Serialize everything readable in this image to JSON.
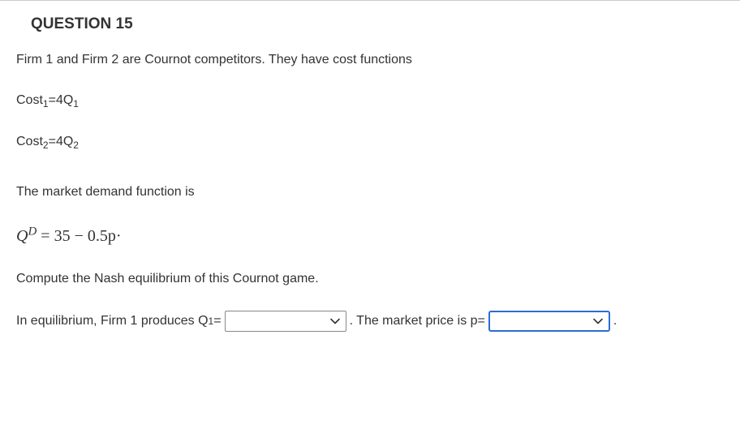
{
  "question": {
    "title": "QUESTION 15",
    "intro": "Firm 1 and Firm 2 are Cournot competitors. They have cost functions",
    "cost1_label": "Cost",
    "cost1_sub": "1",
    "cost1_rhs": "=4Q",
    "cost1_rhs_sub": "1",
    "cost2_label": "Cost",
    "cost2_sub": "2",
    "cost2_rhs": "=4Q",
    "cost2_rhs_sub": "2",
    "demand_intro": "The market demand function is",
    "demand_eq_Q": "Q",
    "demand_eq_sup": "D",
    "demand_eq_rhs": " = 35 − 0.5p",
    "demand_eq_dot": "·",
    "compute": "Compute the Nash equilibrium of this Cournot game.",
    "ans_part1": "In equilibrium, Firm 1 produces Q",
    "ans_part1_sub": "1",
    "ans_part1_eq": "=",
    "ans_part2_prefix": ". The market price is p=",
    "ans_part2_dot_after": "."
  },
  "dropdowns": {
    "q1_value": "",
    "p_value": ""
  }
}
